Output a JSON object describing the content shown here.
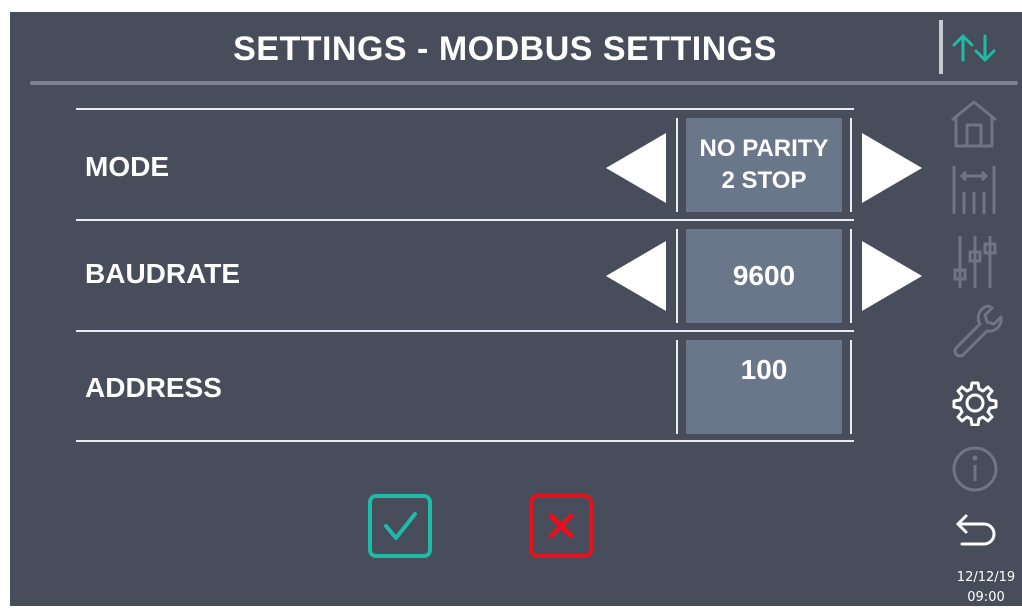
{
  "header": {
    "title": "SETTINGS - MODBUS SETTINGS"
  },
  "rows": [
    {
      "label": "MODE",
      "value_line1": "NO PARITY",
      "value_line2": "2 STOP"
    },
    {
      "label": "BAUDRATE",
      "value": "9600"
    },
    {
      "label": "ADDRESS",
      "value": "100"
    }
  ],
  "sidebar": {
    "icons": [
      "home-icon",
      "levels-icon",
      "sliders-icon",
      "wrench-icon",
      "gear-icon",
      "info-icon",
      "back-icon"
    ],
    "active": "gear-icon"
  },
  "status": {
    "date": "12/12/19",
    "time": "09:00"
  },
  "colors": {
    "background": "#474d5a",
    "value_box": "#6a7689",
    "accent_teal": "#1ebba6",
    "cancel_red": "#e3121c"
  }
}
